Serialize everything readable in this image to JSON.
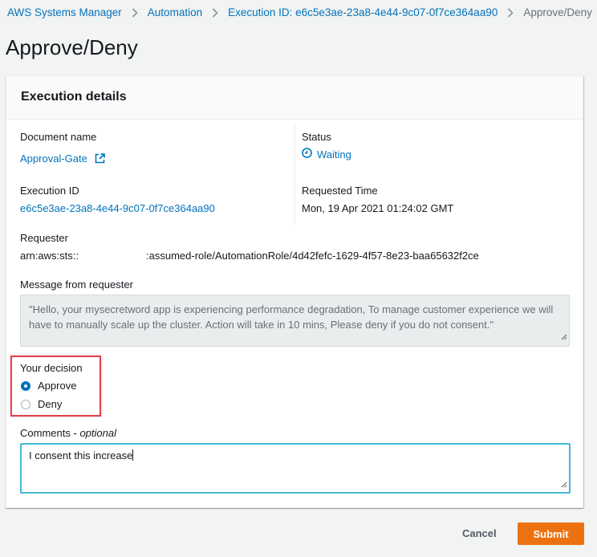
{
  "breadcrumb": {
    "items": [
      {
        "label": "AWS Systems Manager"
      },
      {
        "label": "Automation"
      },
      {
        "label": "Execution ID: e6c5e3ae-23a8-4e44-9c07-0f7ce364aa90"
      }
    ],
    "current": "Approve/Deny",
    "separator_icon": "chevron-right-icon"
  },
  "page": {
    "title": "Approve/Deny"
  },
  "panel": {
    "title": "Execution details",
    "document_name": {
      "label": "Document name",
      "value": "Approval-Gate",
      "icon": "external-link-icon"
    },
    "status": {
      "label": "Status",
      "value": "Waiting",
      "icon": "clock-icon"
    },
    "execution_id": {
      "label": "Execution ID",
      "value": "e6c5e3ae-23a8-4e44-9c07-0f7ce364aa90"
    },
    "requested_time": {
      "label": "Requested Time",
      "value": "Mon, 19 Apr 2021 01:24:02 GMT"
    },
    "requester": {
      "label": "Requester",
      "value_prefix": "arn:aws:sts::",
      "value_suffix": ":assumed-role/AutomationRole/4d42fefc-1629-4f57-8e23-baa65632f2ce"
    },
    "message": {
      "label": "Message from requester",
      "value": "\"Hello, your mysecretword app is experiencing performance degradation, To manage customer experience we will have to manually scale up the cluster. Action will take in 10 mins, Please deny if you do not consent.\""
    },
    "decision": {
      "label": "Your decision",
      "options": [
        {
          "label": "Approve",
          "checked": true
        },
        {
          "label": "Deny",
          "checked": false
        }
      ],
      "highlight_color": "#e0434b"
    },
    "comments": {
      "label": "Comments",
      "label_suffix": "optional",
      "value": "I consent this increase"
    }
  },
  "actions": {
    "cancel": "Cancel",
    "submit": "Submit"
  },
  "colors": {
    "link": "#0073bb",
    "primary_button": "#ec7211",
    "focus_border": "#44b9d6"
  }
}
